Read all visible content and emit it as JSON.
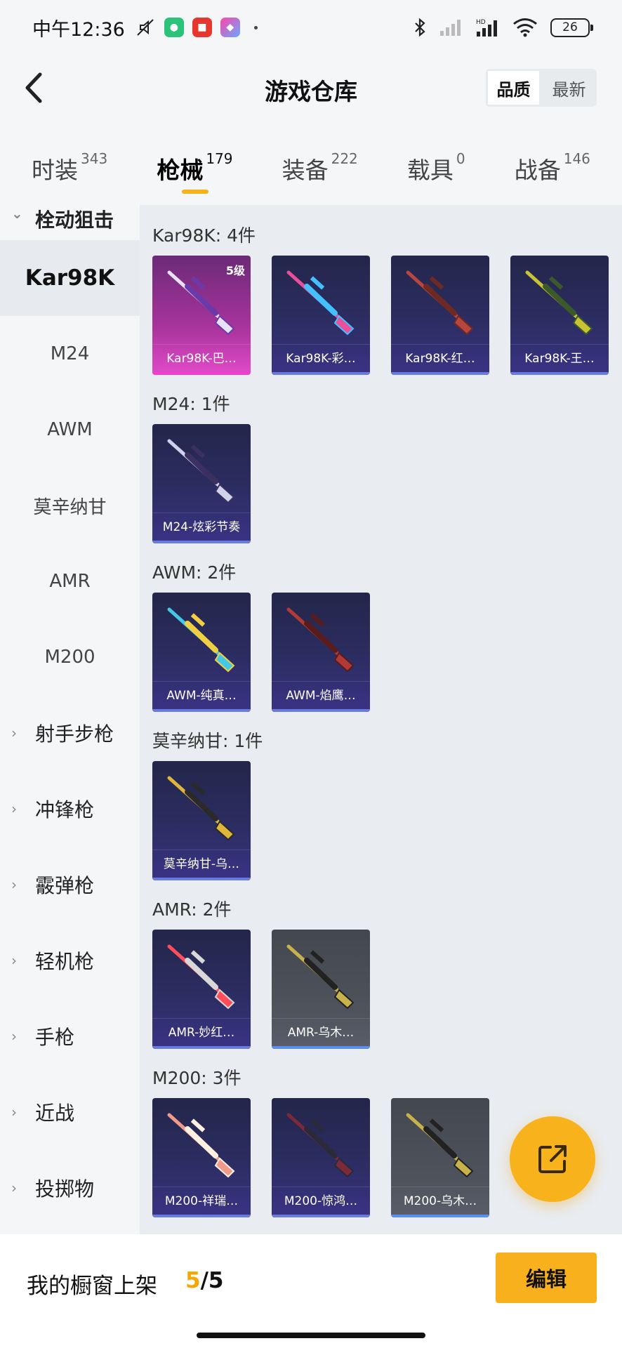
{
  "status_bar": {
    "time": "中午12:36",
    "battery": "26"
  },
  "header": {
    "title": "游戏仓库",
    "sort_options": [
      "品质",
      "最新"
    ],
    "sort_selected": "品质"
  },
  "tabs": [
    {
      "label": "时装",
      "count": "343"
    },
    {
      "label": "枪械",
      "count": "179"
    },
    {
      "label": "装备",
      "count": "222"
    },
    {
      "label": "载具",
      "count": "0"
    },
    {
      "label": "战备",
      "count": "146"
    }
  ],
  "sidebar": {
    "expanded_category": "栓动狙击",
    "sub_items": [
      "Kar98K",
      "M24",
      "AWM",
      "莫辛纳甘",
      "AMR",
      "M200"
    ],
    "active_sub": "Kar98K",
    "categories": [
      "射手步枪",
      "冲锋枪",
      "霰弹枪",
      "轻机枪",
      "手枪",
      "近战",
      "投掷物"
    ]
  },
  "groups": [
    {
      "title": "Kar98K: 4件",
      "items": [
        {
          "name": "Kar98K-巴…",
          "style": "pink",
          "level": "5级"
        },
        {
          "name": "Kar98K-彩…",
          "style": "purple"
        },
        {
          "name": "Kar98K-红…",
          "style": "purple"
        },
        {
          "name": "Kar98K-王…",
          "style": "purple"
        }
      ]
    },
    {
      "title": "M24: 1件",
      "items": [
        {
          "name": "M24-炫彩节奏",
          "style": "purple"
        }
      ]
    },
    {
      "title": "AWM: 2件",
      "items": [
        {
          "name": "AWM-纯真…",
          "style": "purple"
        },
        {
          "name": "AWM-焰鹰…",
          "style": "purple"
        }
      ]
    },
    {
      "title": "莫辛纳甘: 1件",
      "items": [
        {
          "name": "莫辛纳甘-乌…",
          "style": "purple"
        }
      ]
    },
    {
      "title": "AMR: 2件",
      "items": [
        {
          "name": "AMR-妙红…",
          "style": "purple"
        },
        {
          "name": "AMR-乌木…",
          "style": "gray"
        }
      ]
    },
    {
      "title": "M200: 3件",
      "items": [
        {
          "name": "M200-祥瑞…",
          "style": "purple"
        },
        {
          "name": "M200-惊鸿…",
          "style": "purple"
        },
        {
          "name": "M200-乌木…",
          "style": "gray"
        }
      ]
    }
  ],
  "bottom": {
    "shelf_label": "我的橱窗上架",
    "shelf_current": "5",
    "shelf_total": "/5",
    "edit_label": "编辑"
  },
  "colors": {
    "accent": "#f8b21c",
    "card_purple": "#2c2d62",
    "card_pink": "#a8349c",
    "card_gray": "#4f535c"
  },
  "icons": {
    "back": "chevron-left-icon",
    "fab": "share-external-icon"
  }
}
